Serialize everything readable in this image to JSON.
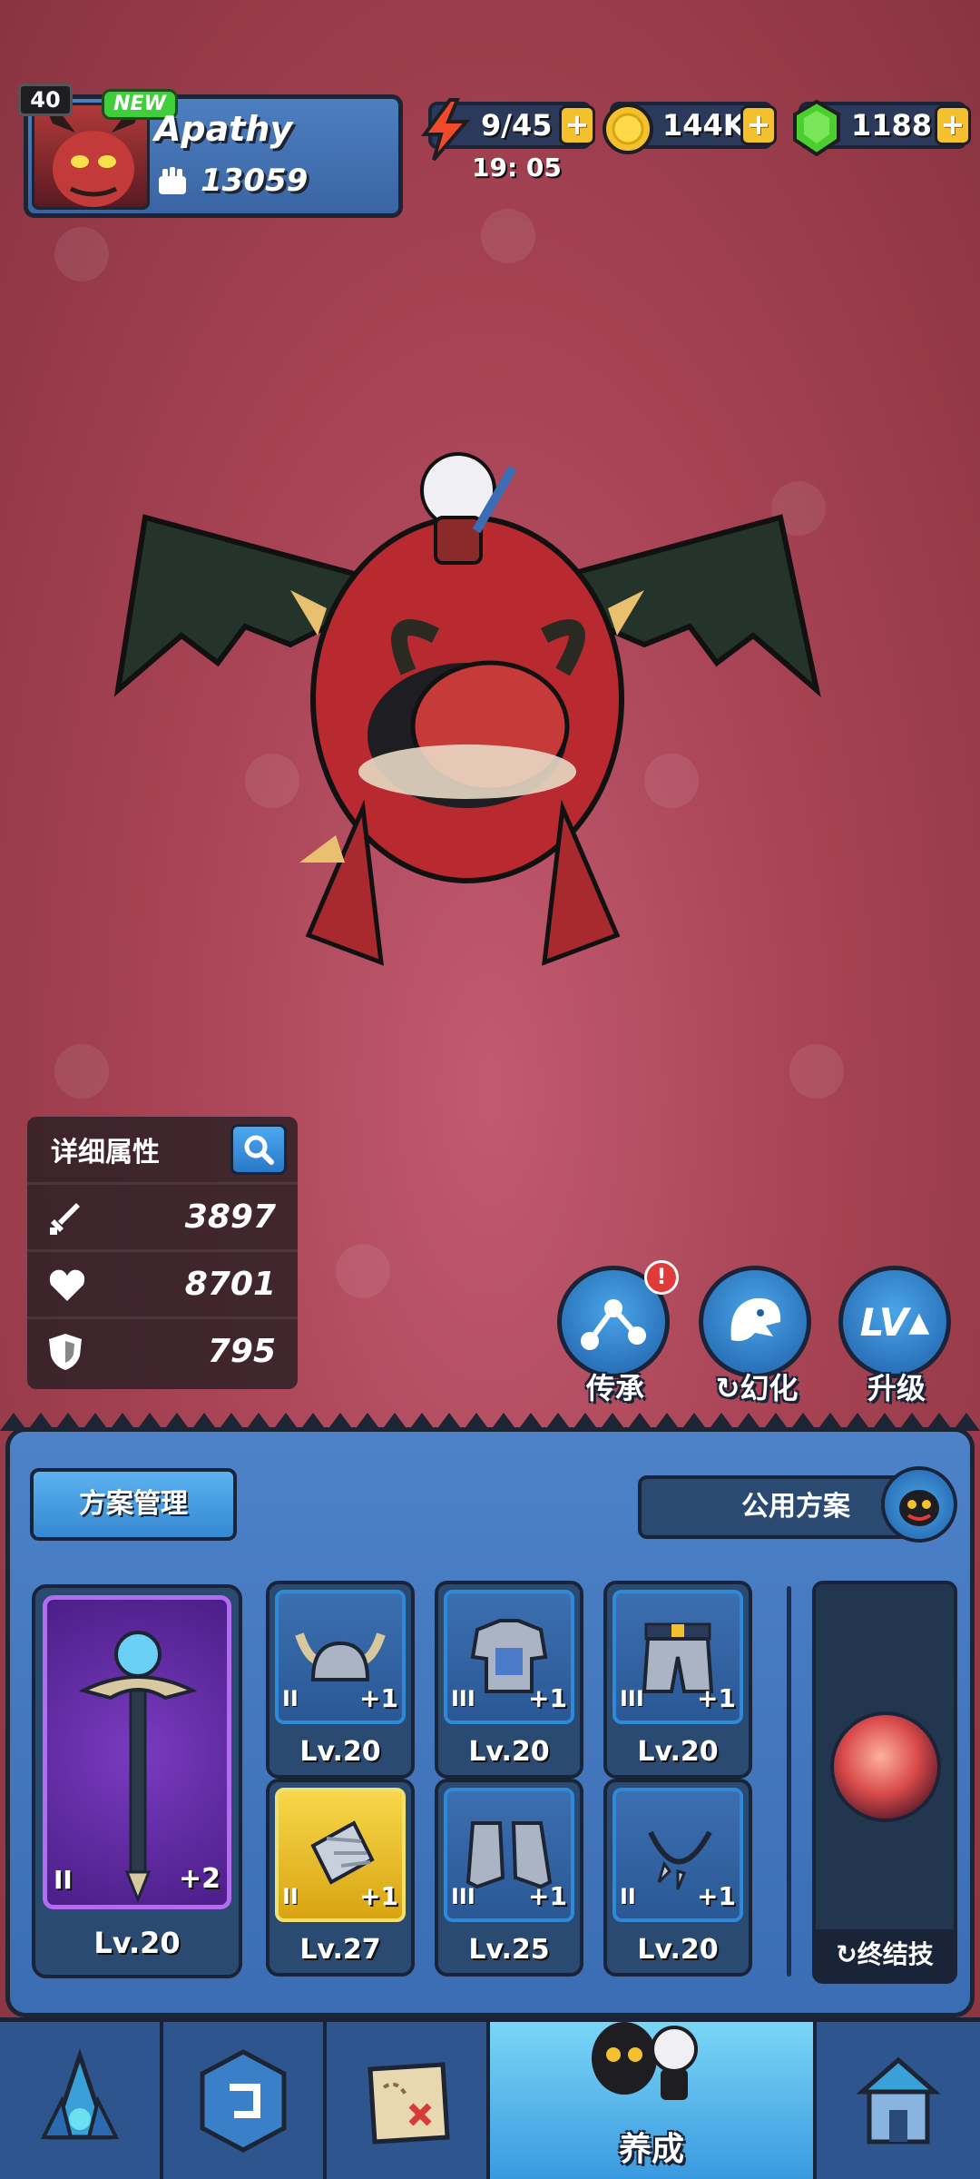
{
  "player": {
    "level": "40",
    "new_badge": "NEW",
    "name": "Apathy",
    "power": "13059"
  },
  "resources": {
    "energy": "9/45",
    "energy_timer": "19: 05",
    "coins": "144K",
    "gems": "1188",
    "plus_label": "+"
  },
  "stats": {
    "title": "详细属性",
    "attack": "3897",
    "health": "8701",
    "defense": "795"
  },
  "actions": {
    "inherit": "传承",
    "inherit_alert": "!",
    "transform": "幻化",
    "upgrade": "升级",
    "upgrade_icon_text": "LV"
  },
  "equipment": {
    "plan_management": "方案管理",
    "public_plan": "公用方案",
    "main_weapon": {
      "tier": "II",
      "plus": "+2",
      "level": "Lv.20"
    },
    "slots": [
      {
        "name": "helmet",
        "tier": "II",
        "plus": "+1",
        "level": "Lv.20",
        "gold": false
      },
      {
        "name": "chest-armor",
        "tier": "III",
        "plus": "+1",
        "level": "Lv.20",
        "gold": false
      },
      {
        "name": "pants",
        "tier": "III",
        "plus": "+1",
        "level": "Lv.20",
        "gold": false
      },
      {
        "name": "bracer",
        "tier": "II",
        "plus": "+1",
        "level": "Lv.27",
        "gold": true
      },
      {
        "name": "boots",
        "tier": "III",
        "plus": "+1",
        "level": "Lv.25",
        "gold": false
      },
      {
        "name": "necklace",
        "tier": "II",
        "plus": "+1",
        "level": "Lv.20",
        "gold": false
      }
    ],
    "ultimate_label": "终结技"
  },
  "nav": {
    "active_label": "养成"
  },
  "colors": {
    "background": "#a84455",
    "panel_blue": "#3a6db3",
    "gold": "#f3c12d",
    "gem_green": "#4bcf2f",
    "epic_purple": "#7a3bc0"
  }
}
